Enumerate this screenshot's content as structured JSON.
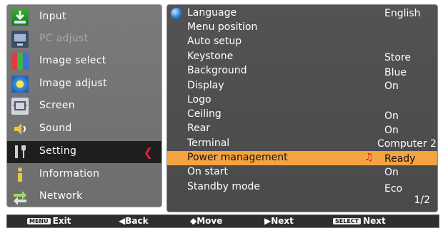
{
  "sidebar": {
    "items": [
      {
        "label": "Input",
        "icon": "input-icon"
      },
      {
        "label": "PC adjust",
        "icon": "pc-adjust-icon"
      },
      {
        "label": "Image select",
        "icon": "image-select-icon"
      },
      {
        "label": "Image adjust",
        "icon": "image-adjust-icon"
      },
      {
        "label": "Screen",
        "icon": "screen-icon"
      },
      {
        "label": "Sound",
        "icon": "sound-icon"
      },
      {
        "label": "Setting",
        "icon": "setting-icon"
      },
      {
        "label": "Information",
        "icon": "information-icon"
      },
      {
        "label": "Network",
        "icon": "network-icon"
      }
    ],
    "selected": "Setting"
  },
  "settings": {
    "rows": [
      {
        "label": "Language",
        "value": "English"
      },
      {
        "label": "Menu position",
        "value": ""
      },
      {
        "label": "Auto setup",
        "value": ""
      },
      {
        "label": "Keystone",
        "value": "Store"
      },
      {
        "label": "Background",
        "value": "Blue"
      },
      {
        "label": "Display",
        "value": "On"
      },
      {
        "label": "Logo",
        "value": ""
      },
      {
        "label": "Ceiling",
        "value": "On"
      },
      {
        "label": "Rear",
        "value": "On"
      },
      {
        "label": "Terminal",
        "value": "Computer 2"
      },
      {
        "label": "Power management",
        "value": "Ready"
      },
      {
        "label": "On start",
        "value": "On"
      },
      {
        "label": "Standby mode",
        "value": "Eco"
      }
    ],
    "highlighted": "Power management",
    "page": "1/2"
  },
  "bottom_bar": {
    "exit_key": "MENU",
    "exit_label": "Exit",
    "back_label": "◀Back",
    "move_label": "◆Move",
    "next_label": "▶Next",
    "select_key": "SELECT",
    "select_label": "Next"
  },
  "colors": {
    "highlight": "#f5a340",
    "selected_arrow": "#d8283a"
  }
}
